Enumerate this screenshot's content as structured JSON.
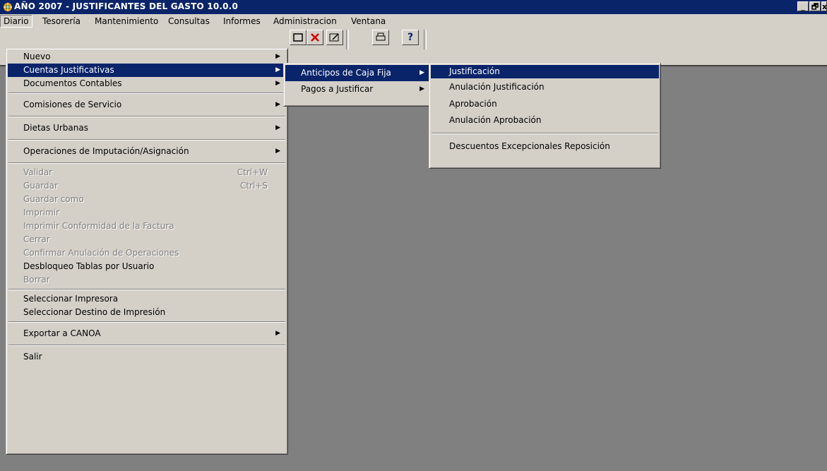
{
  "window": {
    "title": "AÑO 2007 - JUSTIFICANTES DEL GASTO 10.0.0",
    "controls": [
      "_",
      "🗗",
      "x"
    ]
  },
  "menubar": [
    "Diario",
    "Tesorería",
    "Mantenimiento",
    "Consultas",
    "Informes",
    "Administracion",
    "Ventana"
  ],
  "diario_menu": {
    "nuevo": "Nuevo",
    "cuentas_justificativas": "Cuentas Justificativas",
    "documentos_contables": "Documentos Contables",
    "comisiones_servicio": "Comisiones de Servicio",
    "dietas_urbanas": "Dietas Urbanas",
    "operaciones_imputacion": "Operaciones de Imputación/Asignación",
    "validar": "Validar",
    "validar_shortcut": "Ctrl+W",
    "guardar": "Guardar",
    "guardar_shortcut": "Ctrl+S",
    "guardar_como": "Guardar como",
    "imprimir": "Imprimir",
    "imprimir_conformidad": "Imprimir Conformidad de la Factura",
    "cerrar": "Cerrar",
    "confirmar_anulacion": "Confirmar Anulación de Operaciones",
    "desbloqueo_tablas": "Desbloqueo Tablas por Usuario",
    "borrar": "Borrar",
    "seleccionar_impresora": "Seleccionar Impresora",
    "seleccionar_destino": "Seleccionar Destino de Impresión",
    "exportar_canoa": "Exportar a CANOA",
    "salir": "Salir"
  },
  "cuentas_submenu": {
    "anticipos": "Anticipos de Caja Fija",
    "pagos": "Pagos a Justificar"
  },
  "anticipos_submenu": {
    "justificacion": "Justificación",
    "anulacion_justificacion": "Anulación Justificación",
    "aprobacion": "Aprobación",
    "anulacion_aprobacion": "Anulación Aprobación",
    "descuentos": "Descuentos Excepcionales Reposición"
  },
  "toolbar": {
    "help_label": "?"
  },
  "colors": {
    "title_bg": "#0a246a",
    "face": "#d4d0c8",
    "workspace": "#808080",
    "highlight": "#0a246a"
  }
}
